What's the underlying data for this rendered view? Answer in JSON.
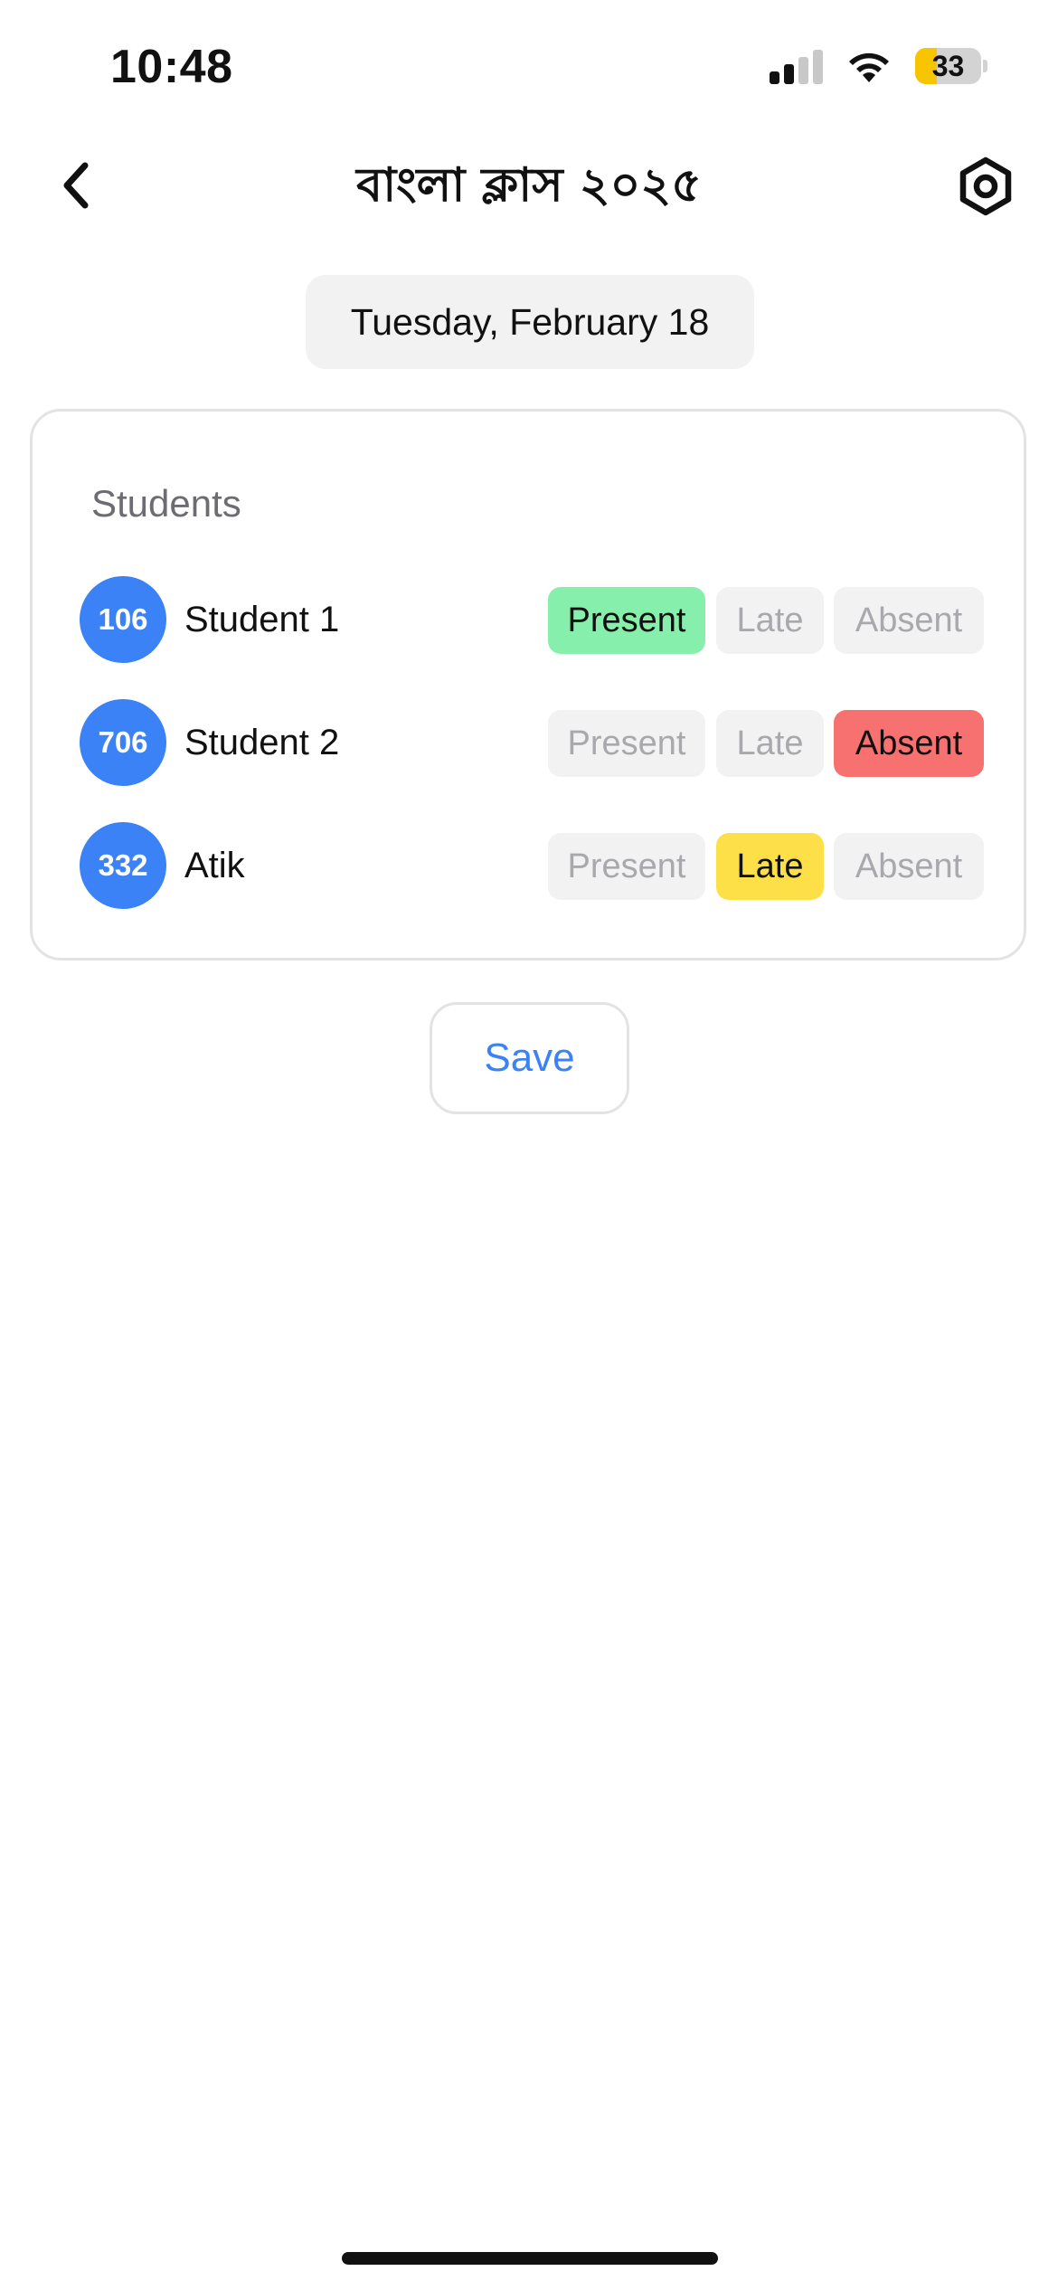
{
  "status_bar": {
    "time": "10:48",
    "battery_level": "33",
    "battery_fraction": 0.33,
    "battery_color": "#f7c500",
    "icons": [
      "cellular-signal-icon",
      "wifi-icon",
      "battery-icon"
    ]
  },
  "nav": {
    "back_icon": "chevron-left-icon",
    "title": "বাংলা ক্লাস ২০২৫",
    "settings_icon": "settings-hexagon-icon"
  },
  "date_label": "Tuesday, February 18",
  "students_card": {
    "title": "Students",
    "status_options": [
      "Present",
      "Late",
      "Absent"
    ],
    "colors": {
      "avatar": "#3b82f6",
      "present": "#86efac",
      "late": "#fde047",
      "absent": "#f87171",
      "unselected": "#f2f2f3"
    },
    "students": [
      {
        "id": "106",
        "name": "Student 1",
        "status": "Present"
      },
      {
        "id": "706",
        "name": "Student 2",
        "status": "Absent"
      },
      {
        "id": "332",
        "name": "Atik",
        "status": "Late"
      }
    ]
  },
  "save_label": "Save"
}
